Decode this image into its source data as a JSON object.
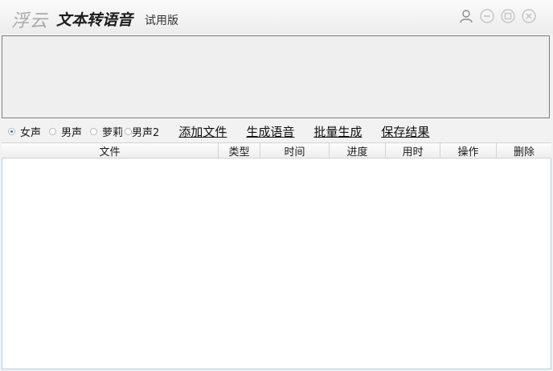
{
  "title_bar": {
    "brand": "浮云",
    "app_name": "文本转语音",
    "edition": "试用版",
    "controls": [
      "user-icon",
      "minimize-icon",
      "maximize-icon",
      "close-icon"
    ]
  },
  "text_input": {
    "value": ""
  },
  "voices": [
    {
      "label": "女声",
      "selected": true
    },
    {
      "label": "男声",
      "selected": false
    },
    {
      "label": "萝莉",
      "selected": false
    },
    {
      "label": "男声2",
      "selected": false
    }
  ],
  "actions": {
    "add_file": "添加文件",
    "generate": "生成语音",
    "batch": "批量生成",
    "save": "保存结果"
  },
  "table": {
    "columns": [
      "文件",
      "类型",
      "时间",
      "进度",
      "用时",
      "操作",
      "删除"
    ],
    "rows": []
  },
  "colors": {
    "accent": "#2a78c8",
    "list_border": "#a8d2ec"
  }
}
